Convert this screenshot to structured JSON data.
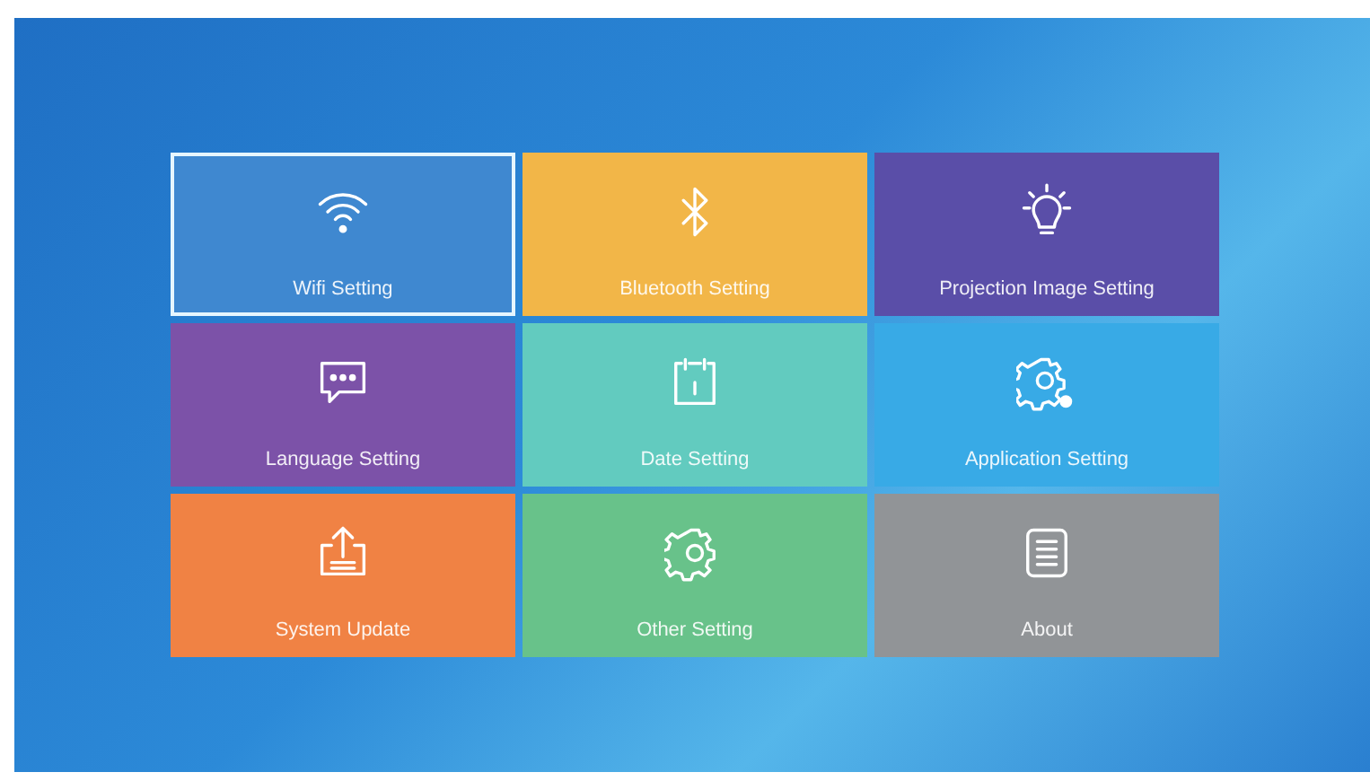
{
  "tiles": [
    {
      "label": "Wifi Setting",
      "kind": "wifi",
      "color": "#3f88d0",
      "selected": true
    },
    {
      "label": "Bluetooth Setting",
      "kind": "bluetooth",
      "color": "#f2b648",
      "selected": false
    },
    {
      "label": "Projection Image Setting",
      "kind": "bulb",
      "color": "#5a4ea8",
      "selected": false
    },
    {
      "label": "Language Setting",
      "kind": "chat",
      "color": "#7c52a8",
      "selected": false
    },
    {
      "label": "Date Setting",
      "kind": "calendar",
      "color": "#62cbbf",
      "selected": false
    },
    {
      "label": "Application Setting",
      "kind": "gears",
      "color": "#38aae6",
      "selected": false
    },
    {
      "label": "System Update",
      "kind": "upload",
      "color": "#f08244",
      "selected": false
    },
    {
      "label": "Other Setting",
      "kind": "gear",
      "color": "#68c28a",
      "selected": false
    },
    {
      "label": "About",
      "kind": "document",
      "color": "#919497",
      "selected": false
    }
  ]
}
